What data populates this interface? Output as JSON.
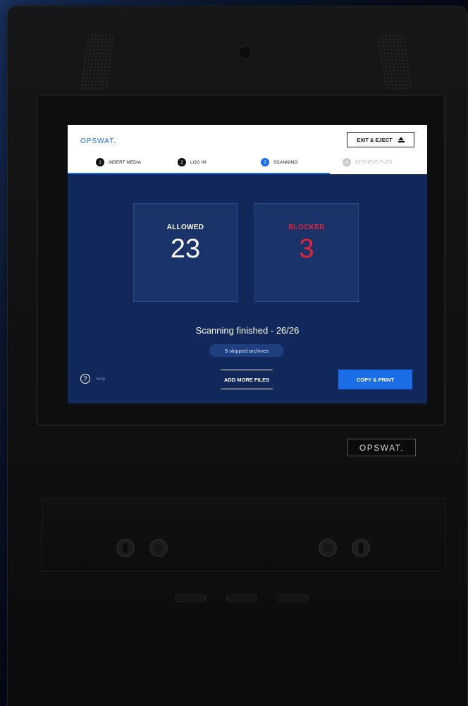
{
  "kiosk": {
    "brand_plate": "OPSWAT."
  },
  "screen": {
    "brand": "OPSWAT.",
    "exit_button": "EXIT & EJECT",
    "steps": [
      {
        "num": "1",
        "label": "INSERT MEDIA",
        "state": "done"
      },
      {
        "num": "2",
        "label": "LOG IN",
        "state": "done"
      },
      {
        "num": "3",
        "label": "SCANNING",
        "state": "active"
      },
      {
        "num": "4",
        "label": "RETRIEVE FILES",
        "state": "future"
      }
    ],
    "allowed": {
      "label": "ALLOWED",
      "value": "23"
    },
    "blocked": {
      "label": "BLOCKED",
      "value": "3"
    },
    "status": "Scanning finished - 26/26",
    "skipped_badge": "9 skipped archives",
    "help": {
      "icon": "?",
      "label": "Help"
    },
    "add_more": "ADD MORE FILES",
    "copy_print": "COPY & PRINT"
  },
  "colors": {
    "accent": "#1c6ee8",
    "screen_bg": "#12285a",
    "blocked": "#e2263a"
  },
  "icons": [
    "eject-icon",
    "help-icon",
    "speaker-grille",
    "camera"
  ]
}
